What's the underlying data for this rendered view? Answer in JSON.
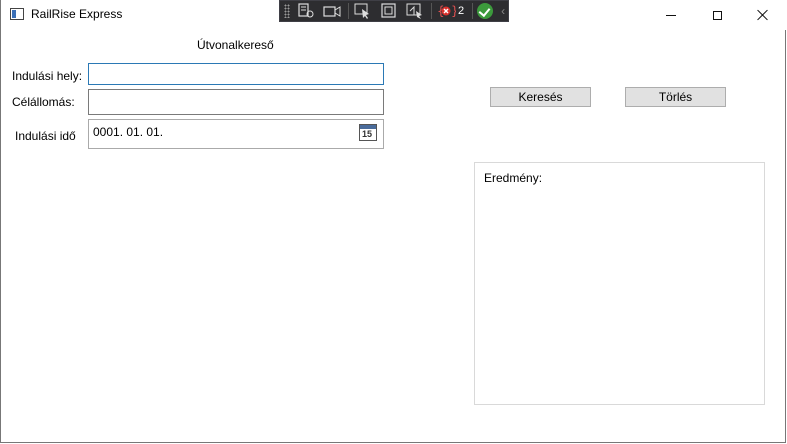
{
  "window": {
    "title": "RailRise Express"
  },
  "debug_toolbar": {
    "binding_errors": "2"
  },
  "form": {
    "heading": "Útvonalkereső",
    "departure_label": "Indulási hely:",
    "departure_value": "",
    "destination_label": "Célállomás:",
    "destination_value": "",
    "time_label": "Indulási idő",
    "date_value": "0001. 01. 01.",
    "calendar_day": "15"
  },
  "actions": {
    "search_label": "Keresés",
    "clear_label": "Törlés"
  },
  "result": {
    "label": "Eredmény:"
  }
}
